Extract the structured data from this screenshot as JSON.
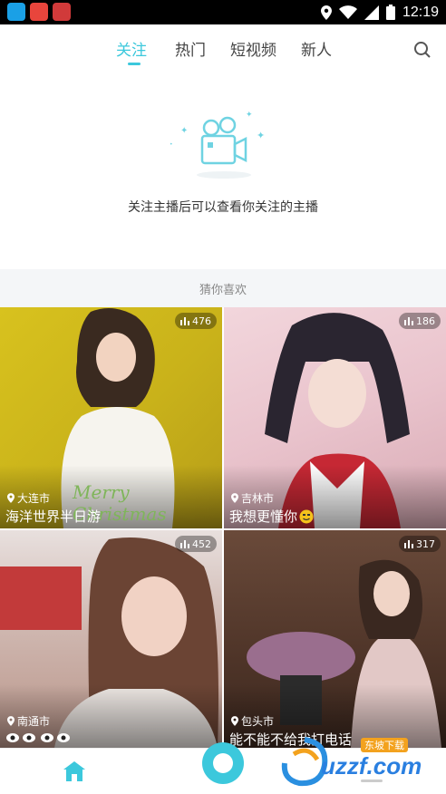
{
  "status_bar": {
    "time": "12:19"
  },
  "nav": {
    "tabs": [
      {
        "label": "关注",
        "active": true
      },
      {
        "label": "热门",
        "active": false
      },
      {
        "label": "短视频",
        "active": false
      },
      {
        "label": "新人",
        "active": false
      }
    ],
    "search_icon": "search-icon"
  },
  "empty_state": {
    "icon": "camera-icon",
    "text": "关注主播后可以查看你关注的主播"
  },
  "recommend": {
    "title": "猜你喜欢",
    "cards": [
      {
        "viewers": "476",
        "city": "大连市",
        "title": "海洋世界半日游",
        "decor_text": "Merry Christmas"
      },
      {
        "viewers": "186",
        "city": "吉林市",
        "title": "我想更懂你"
      },
      {
        "viewers": "452",
        "city": "南通市",
        "title": ""
      },
      {
        "viewers": "317",
        "city": "包头市",
        "title": "能不能不给我打电话"
      }
    ]
  },
  "bottom_bar": {
    "home_icon": "home-icon",
    "live_icon": "live-button-icon"
  },
  "watermark": {
    "text": "uzzf.com",
    "subtext": "东坡下载"
  },
  "colors": {
    "accent": "#3cc8dc",
    "separator_bg": "#f4f6f8"
  }
}
